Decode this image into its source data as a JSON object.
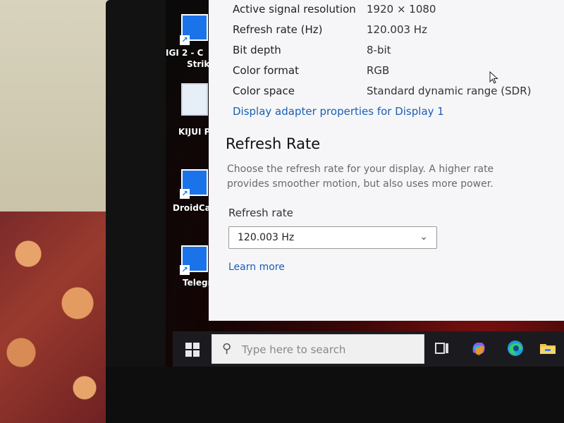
{
  "desktop": {
    "icons": [
      {
        "label_line1": "IGI 2 - C",
        "label_line2": "Strik",
        "icon": "igi2-shortcut-icon"
      },
      {
        "label_line1": "KIJUI P",
        "label_line2": "",
        "icon": "kijui-file-icon"
      },
      {
        "label_line1": "DroidCa",
        "label_line2": "",
        "icon": "droidcam-shortcut-icon"
      },
      {
        "label_line1": "Telegr",
        "label_line2": "",
        "icon": "telegram-shortcut-icon"
      }
    ]
  },
  "display_info": {
    "rows": [
      {
        "label": "Active signal resolution",
        "value": "1920 × 1080"
      },
      {
        "label": "Refresh rate (Hz)",
        "value": "120.003 Hz"
      },
      {
        "label": "Bit depth",
        "value": "8-bit"
      },
      {
        "label": "Color format",
        "value": "RGB"
      },
      {
        "label": "Color space",
        "value": "Standard dynamic range (SDR)"
      }
    ],
    "adapter_link": "Display adapter properties for Display 1"
  },
  "refresh_section": {
    "title": "Refresh Rate",
    "description": "Choose the refresh rate for your display. A higher rate provides smoother motion, but also uses more power.",
    "field_label": "Refresh rate",
    "selected_value": "120.003 Hz",
    "learn_more": "Learn more"
  },
  "taskbar": {
    "search_placeholder": "Type here to search",
    "icons": [
      "start-icon",
      "task-view-icon",
      "copilot-icon",
      "edge-icon",
      "file-explorer-icon"
    ]
  },
  "colors": {
    "link": "#1a5fb4",
    "accent": "#1a73e8",
    "taskbar": "#1b1b1f"
  }
}
